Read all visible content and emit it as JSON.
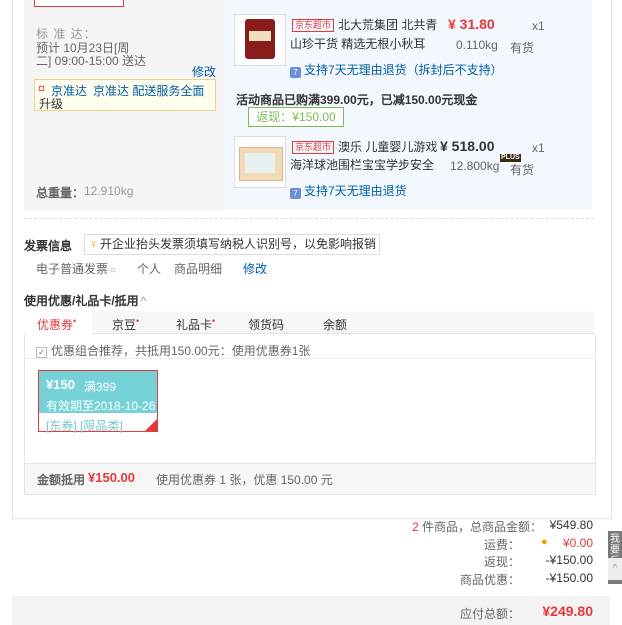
{
  "shipping": {
    "standard_label": "标 准 达：",
    "eta_line1": "预计 10月23日[周",
    "eta_line2": "二] 09:00-15:00 送达",
    "edit": "修改",
    "upgrade_tag": "京准达",
    "upgrade_text1": "京准达 配送服务全面",
    "upgrade_text2": "升级",
    "weight_label": "总重量：",
    "weight_value": "12.910kg"
  },
  "items": [
    {
      "store_tag": "京东超市",
      "name_line1": "北大荒集团 北共青",
      "name_line2": "山珍干货 精选无根小秋耳",
      "price": "¥ 31.80",
      "qty": "x1",
      "weight": "0.110kg",
      "stock": "有货",
      "return_policy": "支持7天无理由退货（拆封后不支持）"
    },
    {
      "store_tag": "京东超市",
      "name_line1": "澳乐 儿童婴儿游戏",
      "name_line2": "海洋球池围栏宝宝学步安全",
      "price": "¥ 518.00",
      "qty": "x1",
      "weight": "12.800kg",
      "plus_badge": "PLUS",
      "stock": "有货",
      "return_policy": "支持7天无理由退货"
    }
  ],
  "promo": {
    "text": "活动商品已购满399.00元，已减150.00元现金",
    "rebate": "返现：¥150.00"
  },
  "invoice": {
    "title": "发票信息",
    "tip": "开企业抬头发票须填写纳税人识别号，以免影响报销",
    "type": "电子普通发票",
    "header": "个人",
    "content": "商品明细",
    "edit": "修改"
  },
  "discount": {
    "section_title": "使用优惠/礼品卡/抵用",
    "tabs": [
      "优惠券",
      "京豆",
      "礼品卡",
      "领货码",
      "余额"
    ],
    "recommend": "优惠组合推荐，共抵用150.00元：使用优惠券1张",
    "coupon_amount": "¥150",
    "coupon_condition": "满399",
    "coupon_valid": "有效期至2018-10-26",
    "coupon_tags": "[东券] [限品类]",
    "deduct_label": "金额抵用",
    "deduct_value": "¥150.00",
    "deduct_desc": "使用优惠券 1 张，优惠 150.00 元"
  },
  "summary": {
    "count_prefix": "2",
    "count_label": "件商品，总商品金额：",
    "total_goods": "¥549.80",
    "shipping_label": "运费：",
    "shipping_value": "¥0.00",
    "rebate_label": "返现：",
    "rebate_value": "-¥150.00",
    "discount_label": "商品优惠：",
    "discount_value": "-¥150.00",
    "payable_label": "应付总额：",
    "payable_value": "¥249.80"
  },
  "side_tab": "我要反馈"
}
